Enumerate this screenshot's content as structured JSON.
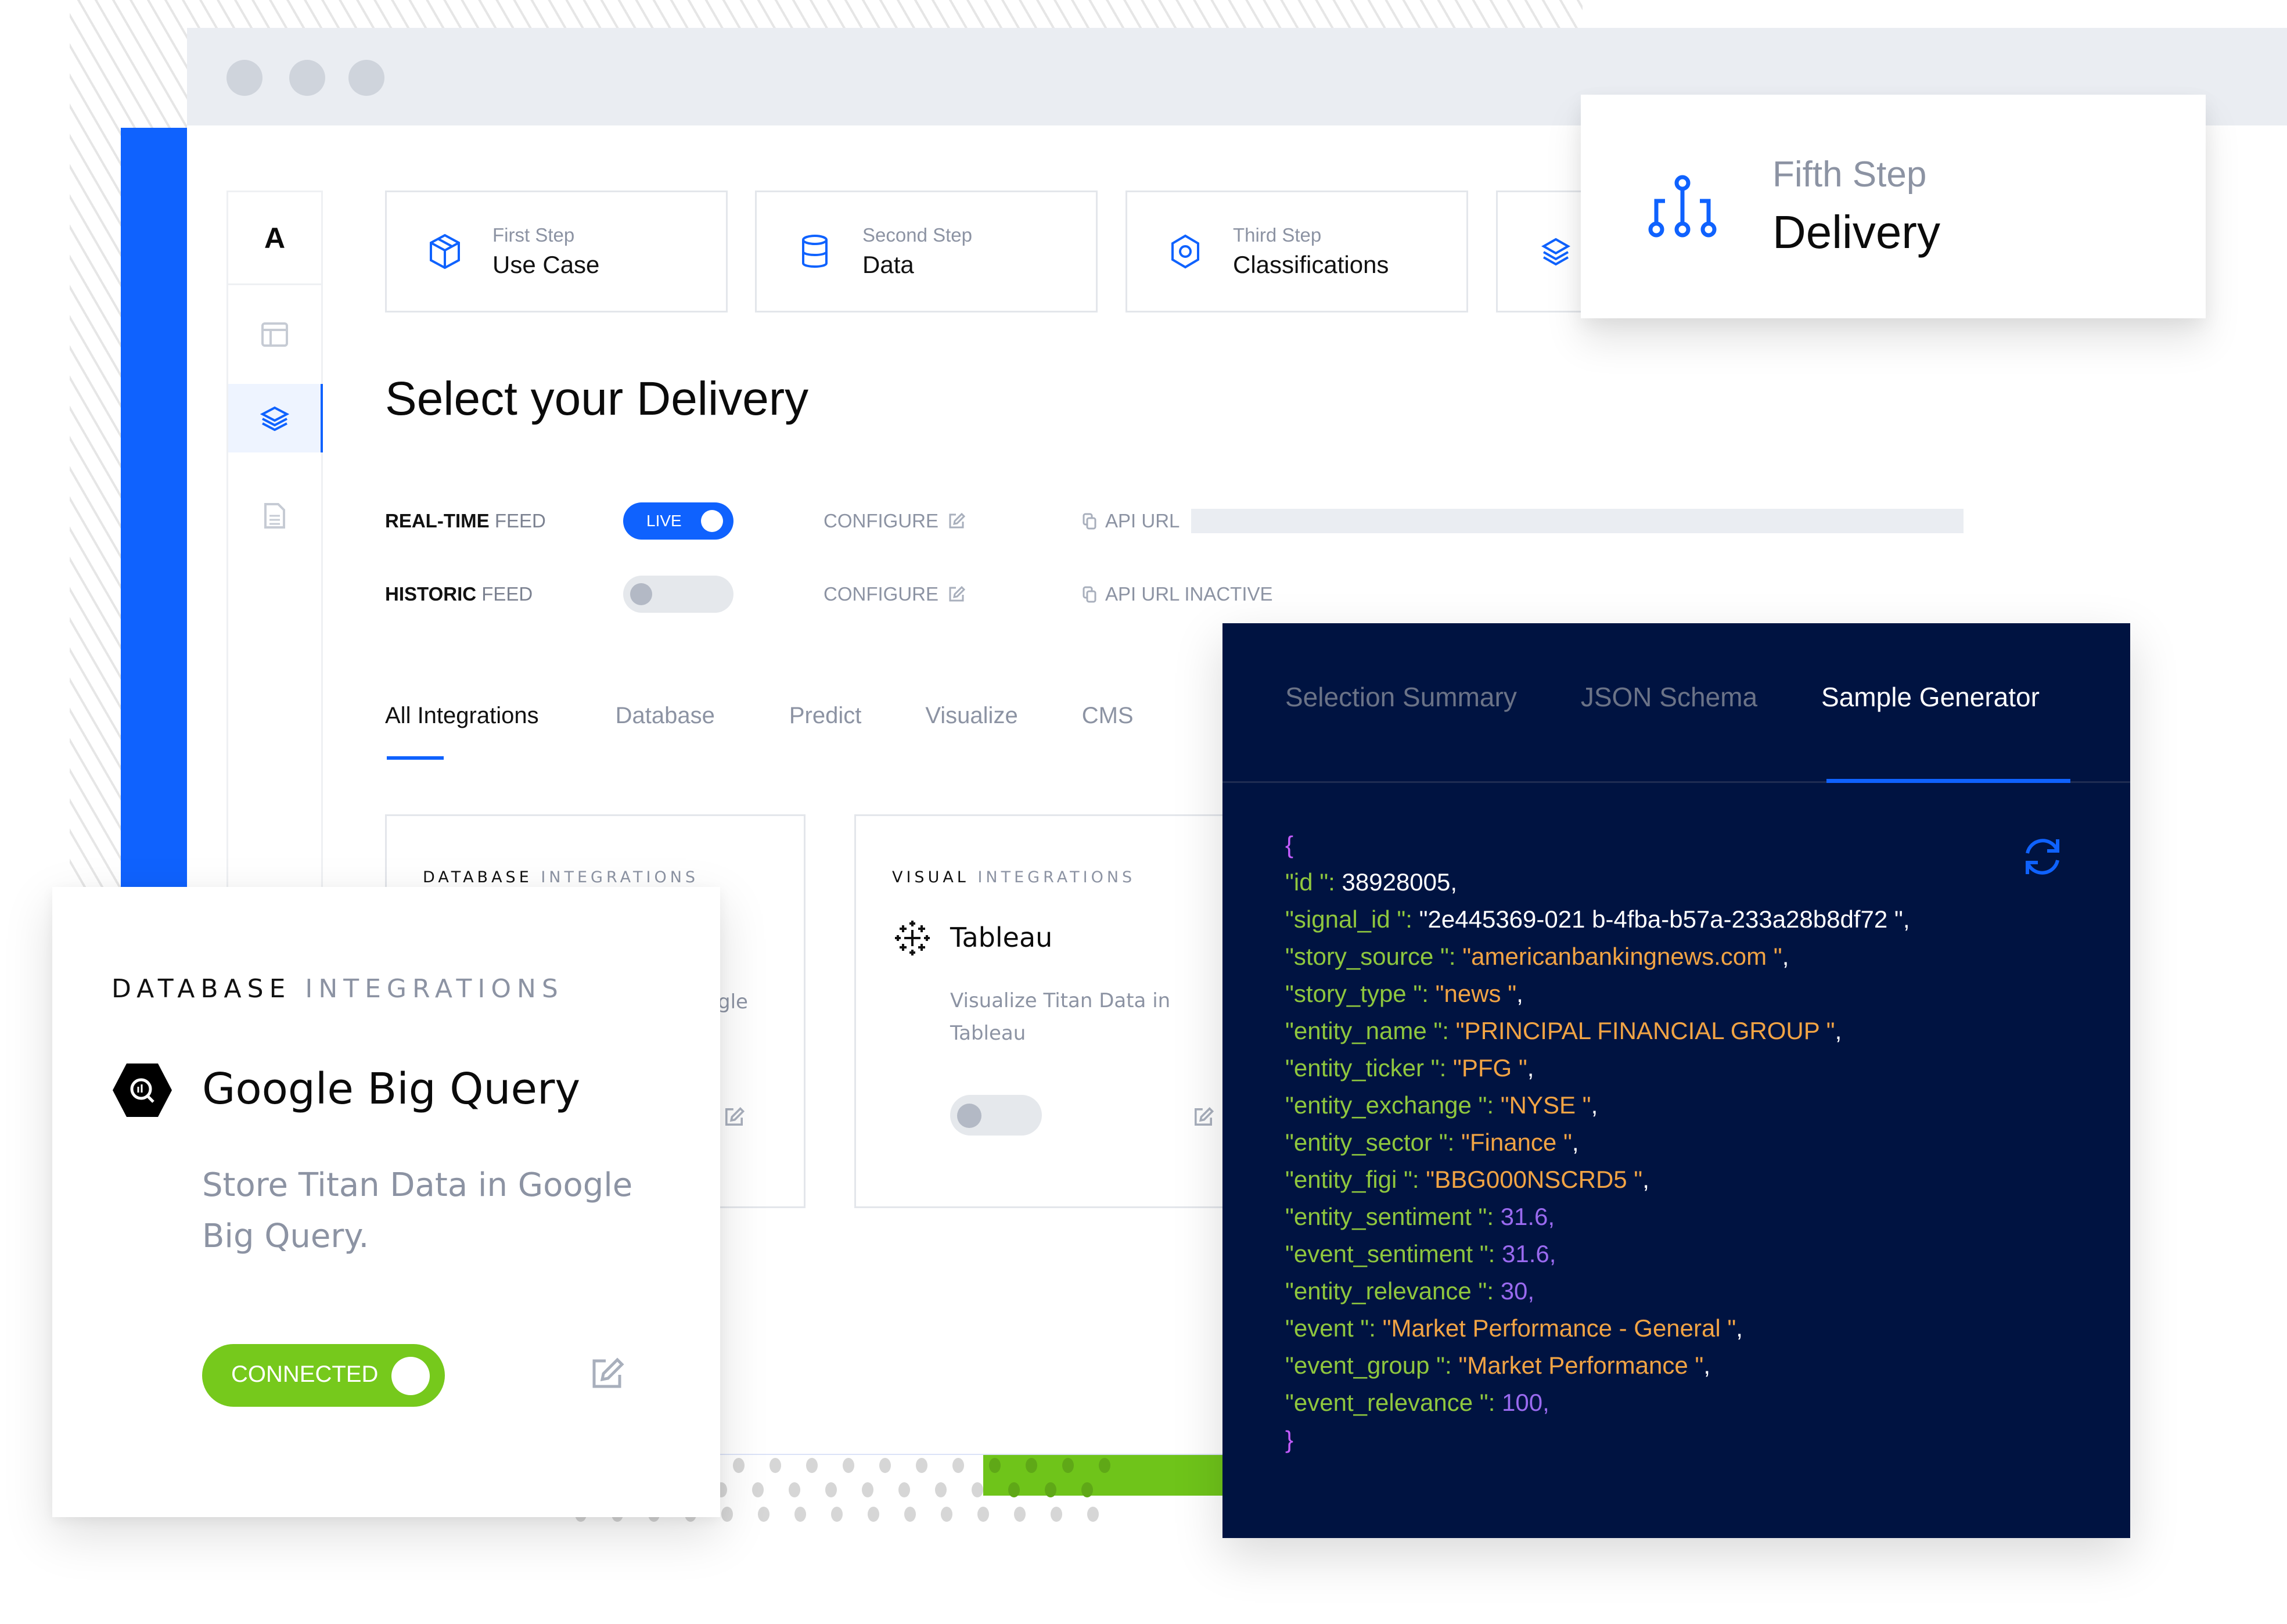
{
  "window": {
    "traffic_lights": [
      "window-dot-1",
      "window-dot-2",
      "window-dot-3"
    ]
  },
  "sidebar": {
    "logo": "A",
    "items": [
      {
        "icon": "layout-icon",
        "active": false
      },
      {
        "icon": "layers-icon",
        "active": true
      },
      {
        "icon": "document-icon",
        "active": false
      }
    ]
  },
  "steps": [
    {
      "sub": "First Step",
      "title": "Use Case",
      "icon": "cube-icon"
    },
    {
      "sub": "Second Step",
      "title": "Data",
      "icon": "database-icon"
    },
    {
      "sub": "Third Step",
      "title": "Classifications",
      "icon": "hexagon-icon"
    },
    {
      "sub": "",
      "title": "",
      "icon": "layers-icon"
    }
  ],
  "fifth_step": {
    "sub": "Fifth Step",
    "title": "Delivery",
    "icon": "hierarchy-icon"
  },
  "page": {
    "title": "Select your Delivery"
  },
  "feeds": [
    {
      "label_bold": "REAL-TIME",
      "label_rest": " FEED",
      "toggle_label": "LIVE",
      "toggle_on": true,
      "configure": "CONFIGURE",
      "api": "API URL"
    },
    {
      "label_bold": "HISTORIC",
      "label_rest": " FEED",
      "toggle_label": "",
      "toggle_on": false,
      "configure": "CONFIGURE",
      "api": "API URL INACTIVE"
    }
  ],
  "tabs": [
    {
      "label": "All Integrations",
      "active": true
    },
    {
      "label": "Database",
      "active": false
    },
    {
      "label": "Predict",
      "active": false
    },
    {
      "label": "Visualize",
      "active": false
    },
    {
      "label": "CMS",
      "active": false
    }
  ],
  "cards": {
    "database": {
      "head_bold": "DATABASE",
      "head_rest": " INTEGRATIONS",
      "partial_text": "gle"
    },
    "visual": {
      "head_bold": "VISUAL",
      "head_rest": " INTEGRATIONS",
      "name": "Tableau",
      "desc": "Visualize Titan Data in Tableau",
      "toggle_on": false
    }
  },
  "gbq": {
    "head_bold": "DATABASE",
    "head_rest": " INTEGRATIONS",
    "name": "Google Big Query",
    "desc": "Store Titan Data in Google Big Query.",
    "toggle_label": "CONNECTED",
    "toggle_on": true
  },
  "panel": {
    "tabs": [
      {
        "label": "Selection Summary",
        "active": false
      },
      {
        "label": "JSON Schema",
        "active": false
      },
      {
        "label": "Sample Generator",
        "active": true
      }
    ],
    "open_brace": "{",
    "close_brace": "}",
    "lines": [
      {
        "key": "\"id \": ",
        "value": "38928005",
        "type": "w",
        "trail": ","
      },
      {
        "key": "\"signal_id \": ",
        "value": "\"2e445369-021 b-4fba-b57a-233a28b8df72 \"",
        "type": "w",
        "trail": ","
      },
      {
        "key": "\"story_source \": ",
        "value": "\"americanbankingnews.com \"",
        "type": "s",
        "trail": ","
      },
      {
        "key": "\"story_type \": ",
        "value": "\"news \"",
        "type": "s",
        "trail": ","
      },
      {
        "key": "\"entity_name \": ",
        "value": "\"PRINCIPAL FINANCIAL GROUP \"",
        "type": "s",
        "trail": ","
      },
      {
        "key": "\"entity_ticker \": ",
        "value": "\"PFG \"",
        "type": "s",
        "trail": ","
      },
      {
        "key": "\"entity_exchange \": ",
        "value": "\"NYSE \"",
        "type": "s",
        "trail": ","
      },
      {
        "key": "\"entity_sector \": ",
        "value": "\"Finance \"",
        "type": "s",
        "trail": ","
      },
      {
        "key": "\"entity_figi \": ",
        "value": "\"BBG000NSCRD5 \"",
        "type": "s",
        "trail": ","
      },
      {
        "key": "\"entity_sentiment \": ",
        "value": "31.6",
        "type": "n",
        "trail": ","
      },
      {
        "key": "\"event_sentiment \": ",
        "value": "31.6",
        "type": "n",
        "trail": ","
      },
      {
        "key": "\"entity_relevance \": ",
        "value": "30",
        "type": "n",
        "trail": ","
      },
      {
        "key": "\"event \": ",
        "value": "\"Market Performance - General \"",
        "type": "s",
        "trail": ","
      },
      {
        "key": "\"event_group \": ",
        "value": "\"Market Performance \"",
        "type": "s",
        "trail": ","
      },
      {
        "key": "\"event_relevance \": ",
        "value": "100",
        "type": "n",
        "trail": ","
      }
    ]
  },
  "colors": {
    "accent": "#0f62fe",
    "connected": "#76c91c",
    "panel_bg": "#001341",
    "json_key": "#8fc73e",
    "json_string": "#f2a444",
    "json_number": "#9a6af0"
  }
}
